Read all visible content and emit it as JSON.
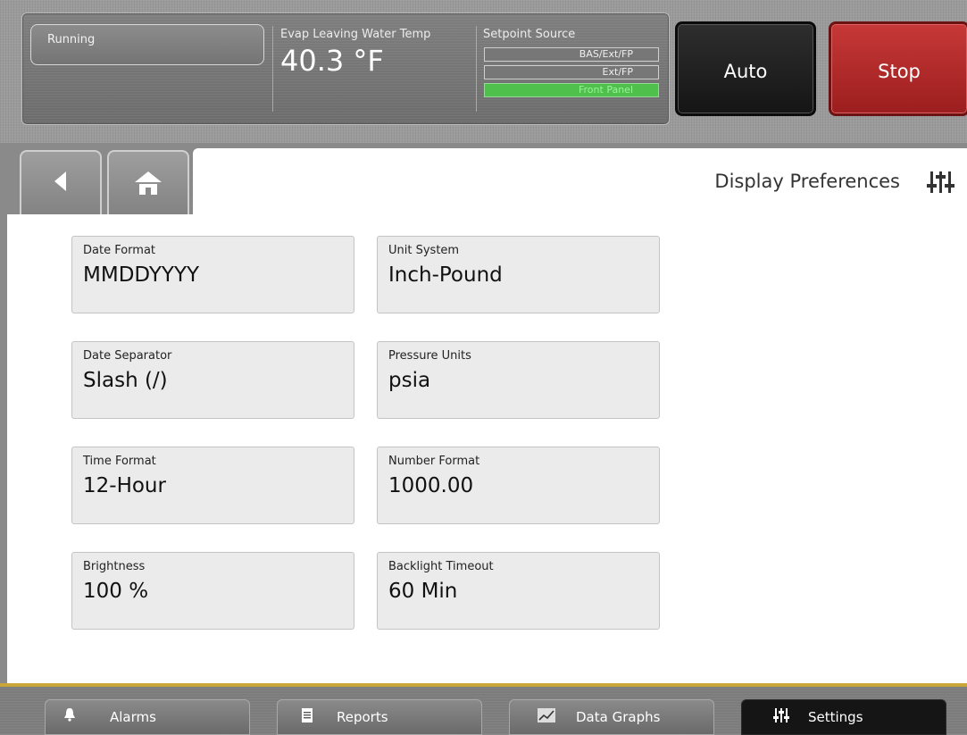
{
  "header": {
    "status": "Running",
    "evap_label": "Evap Leaving Water Temp",
    "evap_value": "40.3 °F",
    "setpoint_label": "Setpoint Source",
    "setpoint_options": [
      "BAS/Ext/FP",
      "Ext/FP",
      "Front Panel"
    ],
    "setpoint_active": "Front Panel",
    "auto_label": "Auto",
    "stop_label": "Stop"
  },
  "nav": {
    "back_icon": "back-arrow-icon",
    "home_icon": "home-icon"
  },
  "page": {
    "title": "Display Preferences",
    "title_icon": "settings-sliders-icon"
  },
  "preferences": [
    {
      "label": "Date Format",
      "value": "MMDDYYYY"
    },
    {
      "label": "Unit System",
      "value": "Inch-Pound"
    },
    {
      "label": "Date Separator",
      "value": "Slash (/)"
    },
    {
      "label": "Pressure Units",
      "value": "psia"
    },
    {
      "label": "Time Format",
      "value": "12-Hour"
    },
    {
      "label": "Number Format",
      "value": "1000.00"
    },
    {
      "label": "Brightness",
      "value": "100 %"
    },
    {
      "label": "Backlight Timeout",
      "value": "60 Min"
    }
  ],
  "footer": {
    "tabs": [
      {
        "label": "Alarms",
        "icon": "bell-icon"
      },
      {
        "label": "Reports",
        "icon": "document-icon"
      },
      {
        "label": "Data Graphs",
        "icon": "graph-icon"
      },
      {
        "label": "Settings",
        "icon": "settings-sliders-icon"
      }
    ],
    "active": "Settings"
  },
  "colors": {
    "active_source": "#4fc04b",
    "stop_button": "#b02a2a",
    "auto_button": "#1e1e1e",
    "footer_accent": "#caa63a"
  }
}
